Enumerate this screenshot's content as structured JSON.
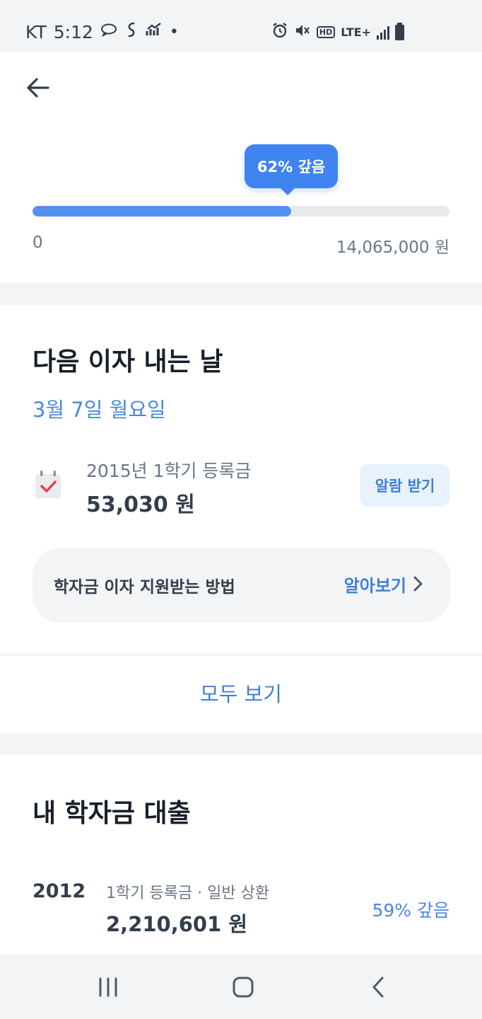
{
  "status": {
    "carrier": "KT",
    "time": "5:12",
    "hd": "HD",
    "network": "LTE+"
  },
  "progress": {
    "tip": "62% 갚음",
    "percent": 62,
    "min": "0",
    "max": "14,065,000 원"
  },
  "next": {
    "title": "다음 이자 내는 날",
    "date": "3월 7일 월요일",
    "item_label": "2015년 1학기 등록금",
    "item_amount": "53,030 원",
    "alarm_label": "알람 받기"
  },
  "support": {
    "text": "학자금 이자 지원받는 방법",
    "link": "알아보기"
  },
  "view_all": "모두 보기",
  "loans": {
    "title": "내 학자금 대출",
    "items": [
      {
        "year": "2012",
        "desc": "1학기 등록금 · 일반 상환",
        "amount": "2,210,601 원",
        "percent": "59% 갚음"
      }
    ]
  },
  "colors": {
    "accent": "#3f84ef",
    "progress_fill": "#5590ee",
    "link_blue": "#3f7fd6",
    "band_gray": "#f2f4f6"
  }
}
